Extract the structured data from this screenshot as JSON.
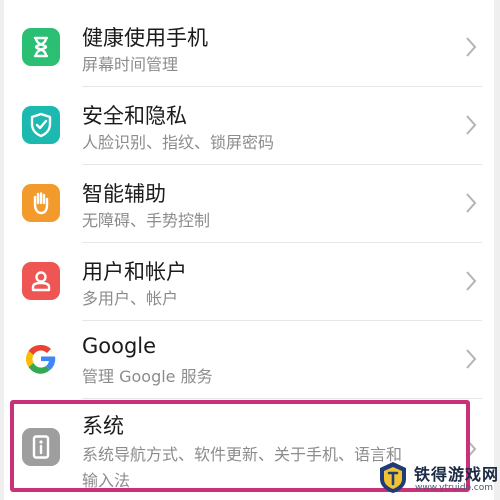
{
  "colors": {
    "health": "#2bbf73",
    "security": "#1cb9b0",
    "assist": "#f39a2c",
    "users": "#ef5653",
    "system": "#9e9e9e",
    "highlight": "#c9317a"
  },
  "settings": {
    "items": [
      {
        "title": "健康使用手机",
        "subtitle": "屏幕时间管理",
        "icon": "hourglass-icon"
      },
      {
        "title": "安全和隐私",
        "subtitle": "人脸识别、指纹、锁屏密码",
        "icon": "shield-check-icon"
      },
      {
        "title": "智能辅助",
        "subtitle": "无障碍、手势控制",
        "icon": "hand-icon"
      },
      {
        "title": "用户和帐户",
        "subtitle": "多用户、帐户",
        "icon": "user-icon"
      },
      {
        "title": "Google",
        "subtitle": "管理 Google 服务",
        "icon": "google-icon"
      },
      {
        "title": "系统",
        "subtitle": "系统导航方式、软件更新、关于手机、语言和",
        "subtitle2": "输入法",
        "icon": "system-info-icon"
      }
    ]
  },
  "watermark": {
    "name": "铁得游戏网",
    "url": "www.ytruido.com"
  }
}
